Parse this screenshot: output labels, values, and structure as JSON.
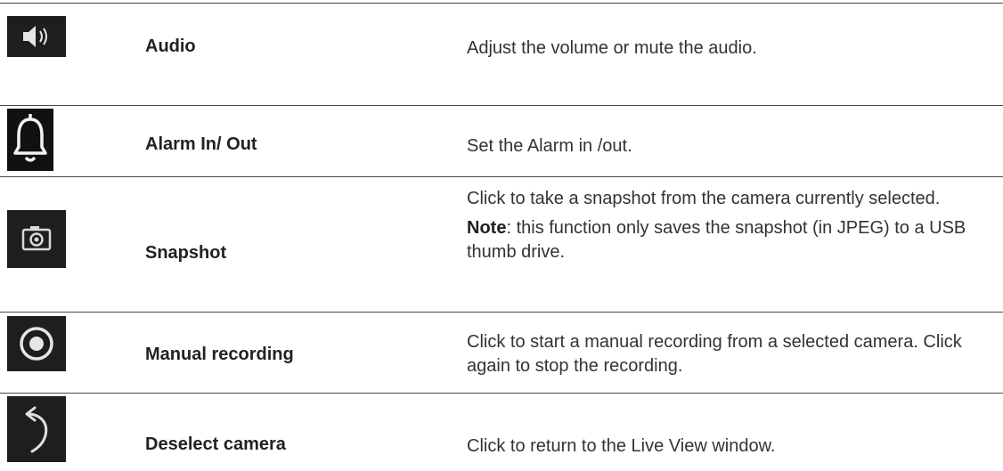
{
  "rows": [
    {
      "icon": "speaker-icon",
      "name": "Audio",
      "description": "Adjust the volume or mute the audio."
    },
    {
      "icon": "bell-icon",
      "name": "Alarm In/ Out",
      "description": "Set the Alarm in /out."
    },
    {
      "icon": "camera-icon",
      "name": "Snapshot",
      "description": "Click to take a snapshot from the camera currently selected.",
      "note_label": "Note",
      "note_text": ": this function only saves the snapshot (in JPEG) to a USB thumb drive."
    },
    {
      "icon": "record-icon",
      "name": "Manual recording",
      "description": "Click to start a manual recording from a selected camera. Click again to stop the recording."
    },
    {
      "icon": "undo-arrow-icon",
      "name": "Deselect camera",
      "description": "Click to return to the Live View window."
    }
  ],
  "colors": {
    "icon_bg": "#1e1e1e",
    "icon_fg": "#e6e6e6",
    "rule": "#4a4a4a",
    "text": "#333333"
  }
}
